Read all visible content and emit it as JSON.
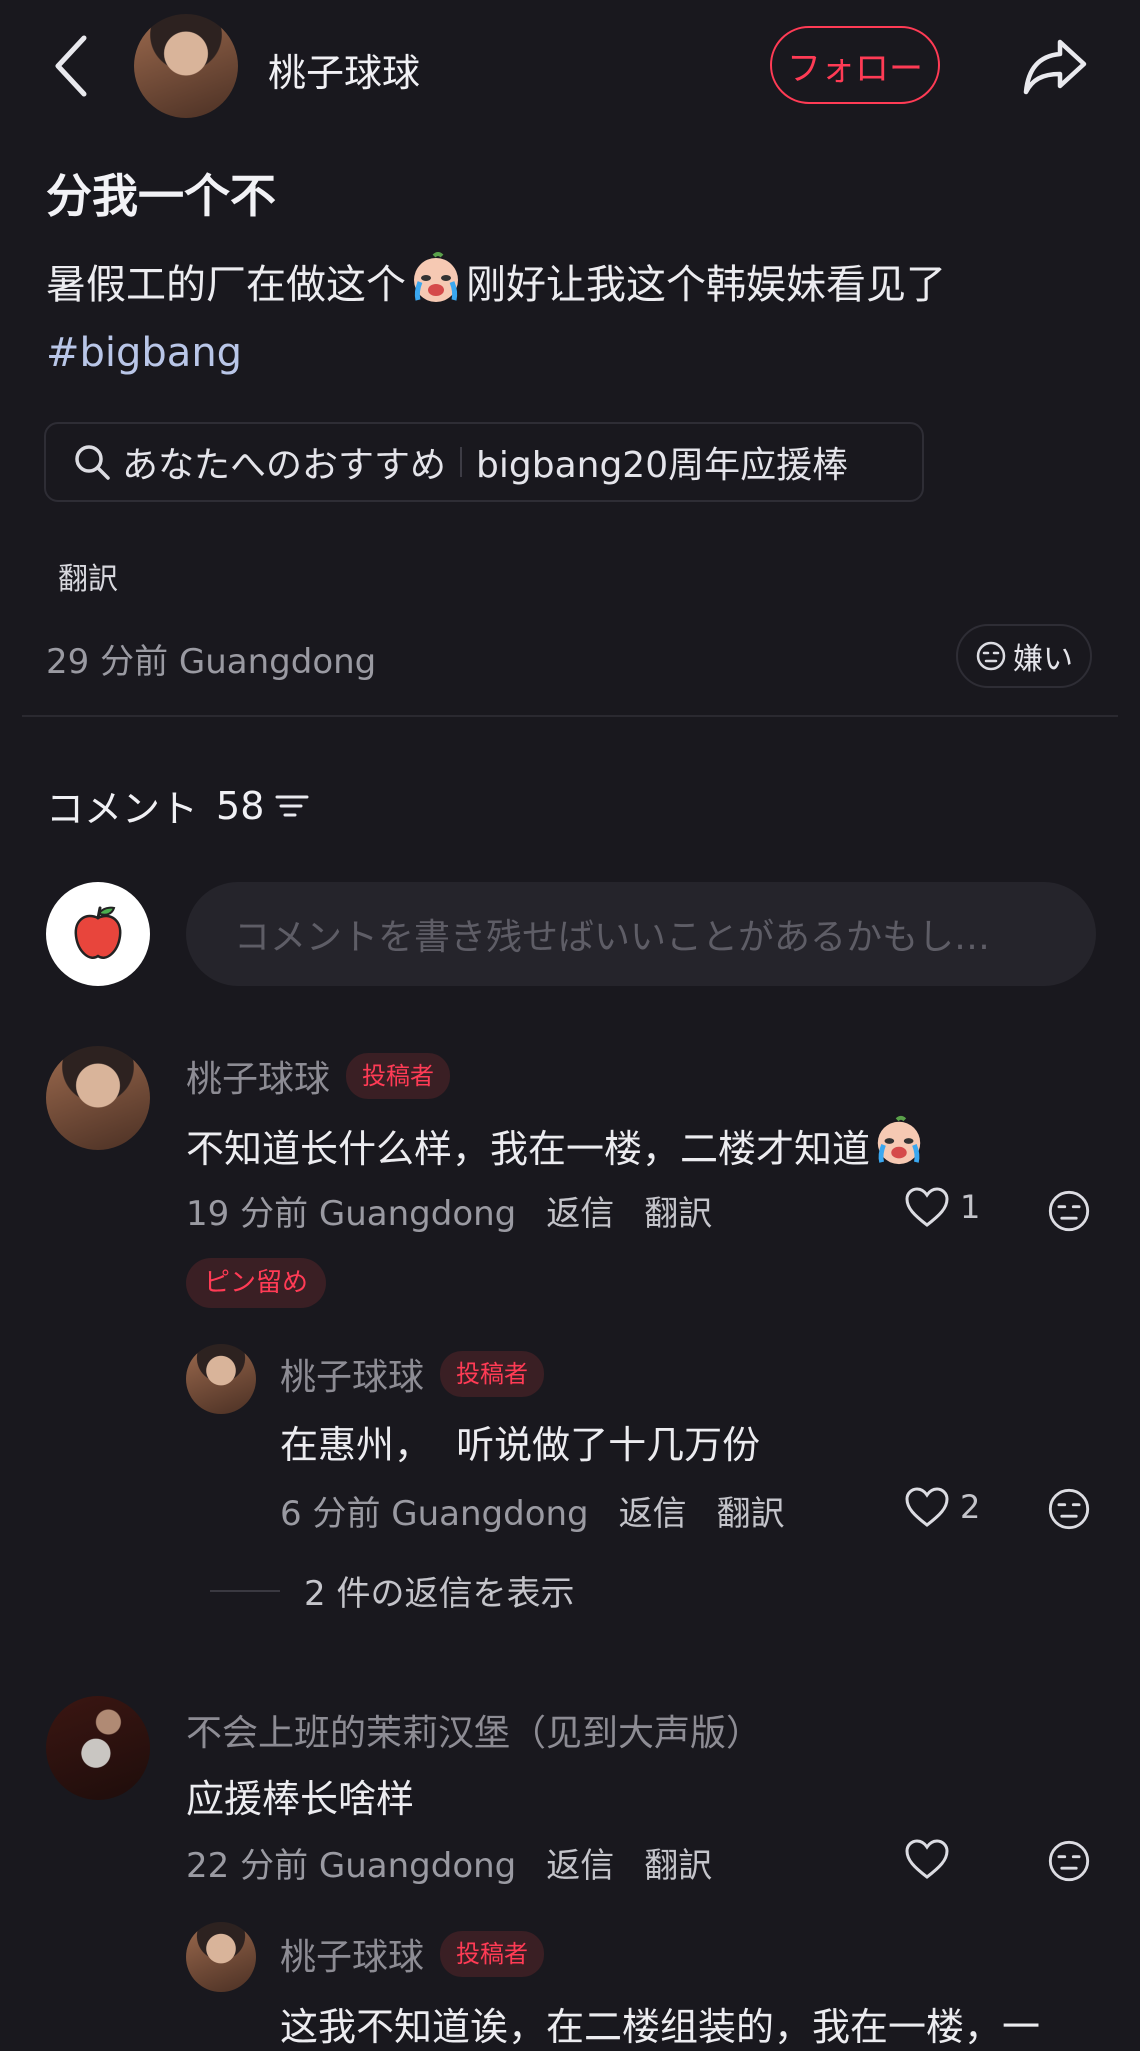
{
  "header": {
    "username": "桃子球球",
    "follow_label": "フォロー"
  },
  "post": {
    "title": "分我一个不",
    "body_part1": "暑假工的厂在做这个",
    "body_part2": "刚好让我这个韩娱妹看见了",
    "hashtag": "#bigbang",
    "search_prefix": "あなたへのおすすめ",
    "search_term": "bigbang20周年应援棒",
    "translate_label": "翻訳",
    "meta": "29 分前 Guangdong",
    "dislike_label": "嫌い"
  },
  "comments_header": {
    "label": "コメント",
    "count": "58"
  },
  "comment_input": {
    "placeholder": "コメントを書き残せばいいことがあるかもし…"
  },
  "comments": [
    {
      "author": "桃子球球",
      "badge": "投稿者",
      "text": "不知道长什么样，我在一楼，二楼才知道",
      "meta": "19 分前 Guangdong",
      "reply_label": "返信",
      "translate_label": "翻訳",
      "likes": "1",
      "pin_label": "ピン留め"
    },
    {
      "author": "桃子球球",
      "badge": "投稿者",
      "text": "在惠州，  听说做了十几万份",
      "meta": "6 分前 Guangdong",
      "reply_label": "返信",
      "translate_label": "翻訳",
      "likes": "2",
      "show_replies": "2 件の返信を表示"
    },
    {
      "author": "不会上班的茉莉汉堡（见到大声版）",
      "text": "应援棒长啥样",
      "meta": "22 分前 Guangdong",
      "reply_label": "返信",
      "translate_label": "翻訳"
    },
    {
      "author": "桃子球球",
      "badge": "投稿者",
      "text": "这我不知道诶，在二楼组装的，我在一楼，一"
    }
  ],
  "colors": {
    "background": "#19181e",
    "accent": "#ff3b55",
    "hashtag": "#b9c6e8"
  }
}
